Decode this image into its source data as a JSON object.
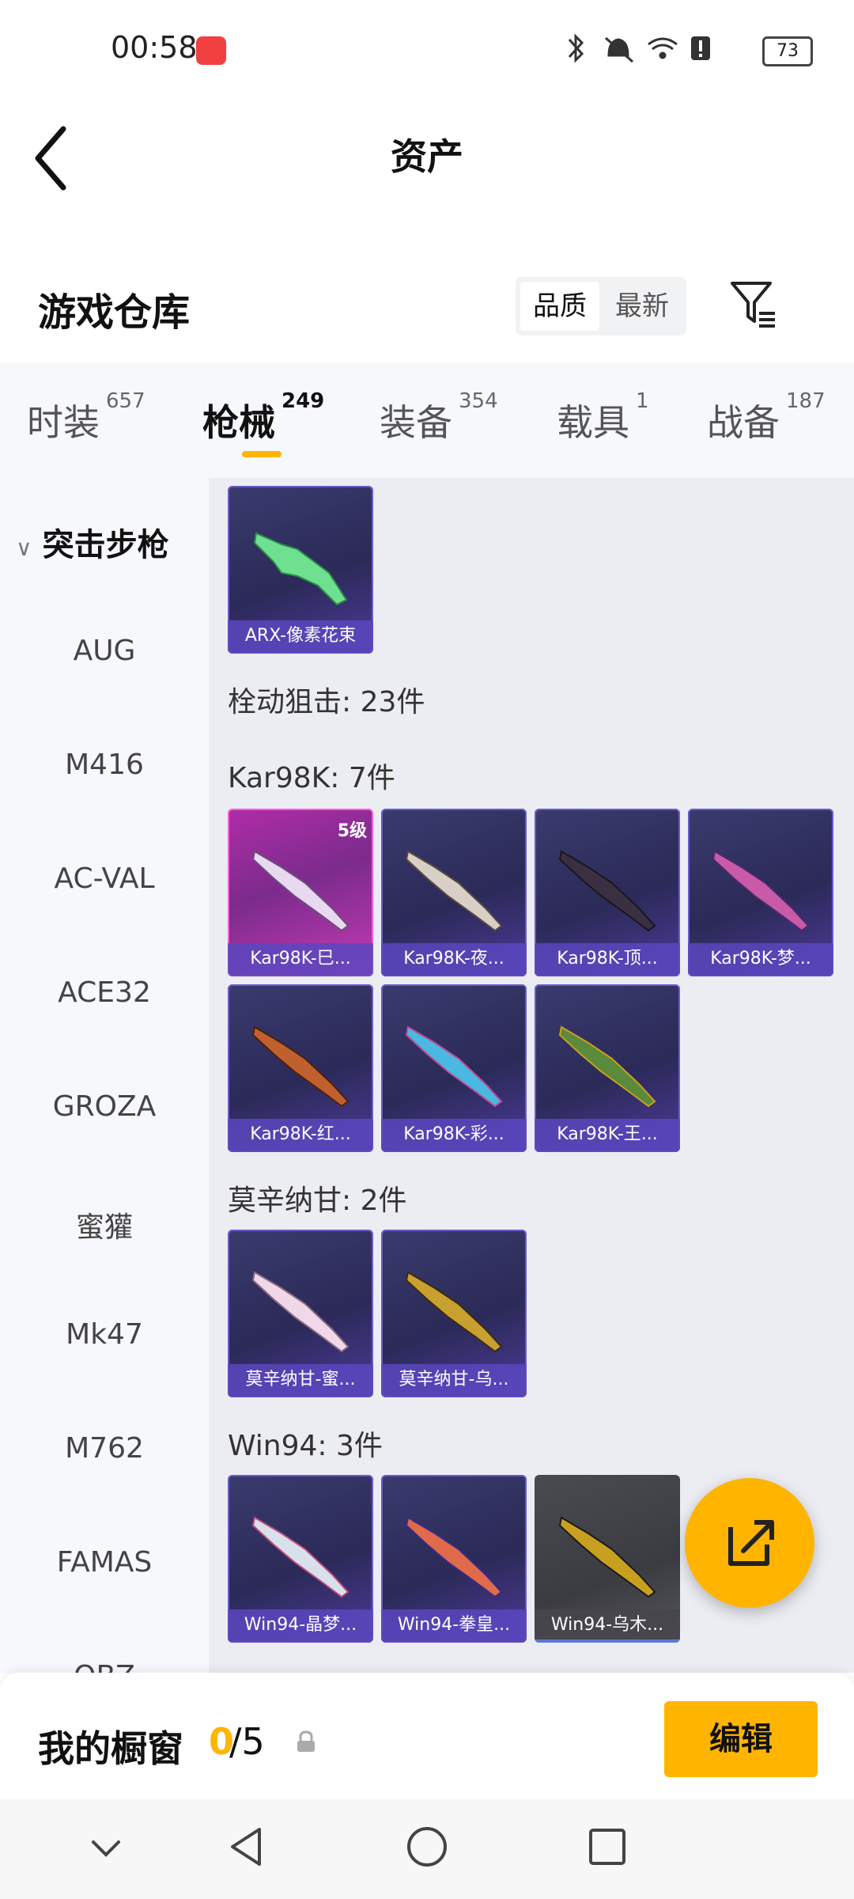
{
  "status_bar": {
    "time": "00:58",
    "battery": "73",
    "icons": [
      "bluetooth-icon",
      "bell-muted-icon",
      "wifi-icon",
      "alert-icon",
      "battery-icon"
    ]
  },
  "header": {
    "title": "资产",
    "back_icon": "chevron-left-icon"
  },
  "warehouse": {
    "title": "游戏仓库",
    "sort_options": [
      "品质",
      "最新"
    ],
    "selected_sort": "品质",
    "filter_icon": "filter-icon"
  },
  "tabs": [
    {
      "label": "时装",
      "count": "657"
    },
    {
      "label": "枪械",
      "count": "249"
    },
    {
      "label": "装备",
      "count": "354"
    },
    {
      "label": "载具",
      "count": "1"
    },
    {
      "label": "战备",
      "count": "187"
    }
  ],
  "active_tab": "枪械",
  "sidebar": {
    "group": "突击步枪",
    "items": [
      "AUG",
      "M416",
      "AC-VAL",
      "ACE32",
      "GROZA",
      "蜜獾",
      "Mk47",
      "M762",
      "FAMAS",
      "QBZ"
    ]
  },
  "sections": [
    {
      "label": "",
      "items": [
        {
          "name": "ARX-像素花束",
          "rarity": "blue",
          "level": ""
        }
      ]
    },
    {
      "label": "栓动狙击: 23件",
      "items": []
    },
    {
      "label": "Kar98K: 7件",
      "items": [
        {
          "name": "Kar98K-巳...",
          "rarity": "purple",
          "level": "5级"
        },
        {
          "name": "Kar98K-夜...",
          "rarity": "blue",
          "level": ""
        },
        {
          "name": "Kar98K-顶...",
          "rarity": "blue",
          "level": ""
        },
        {
          "name": "Kar98K-梦...",
          "rarity": "blue",
          "level": ""
        },
        {
          "name": "Kar98K-红...",
          "rarity": "blue",
          "level": ""
        },
        {
          "name": "Kar98K-彩...",
          "rarity": "blue",
          "level": ""
        },
        {
          "name": "Kar98K-王...",
          "rarity": "blue",
          "level": ""
        }
      ]
    },
    {
      "label": "莫辛纳甘: 2件",
      "items": [
        {
          "name": "莫辛纳甘-蜜...",
          "rarity": "blue",
          "level": ""
        },
        {
          "name": "莫辛纳甘-乌...",
          "rarity": "blue",
          "level": ""
        }
      ]
    },
    {
      "label": "Win94: 3件",
      "items": [
        {
          "name": "Win94-晶梦...",
          "rarity": "blue",
          "level": ""
        },
        {
          "name": "Win94-拳皇...",
          "rarity": "blue",
          "level": ""
        },
        {
          "name": "Win94-乌木...",
          "rarity": "gray",
          "level": ""
        }
      ]
    }
  ],
  "fab_icon": "share-export-icon",
  "showcase": {
    "label": "我的橱窗",
    "current": "0",
    "total": "/5",
    "lock_icon": "lock-icon",
    "edit_label": "编辑"
  },
  "nav": [
    "chevron-down-icon",
    "back-triangle-icon",
    "home-circle-icon",
    "recents-square-icon"
  ],
  "colors": {
    "accent": "#ffb400",
    "card_blue": "#3a3b6e",
    "card_purple": "#b02ca8",
    "card_gray": "#4a4b50"
  }
}
